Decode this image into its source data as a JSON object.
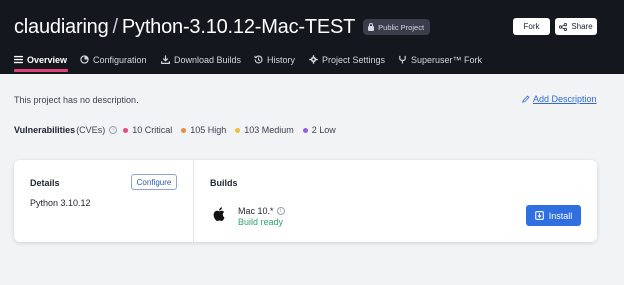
{
  "header": {
    "owner": "claudiaring",
    "separator": "/",
    "project": "Python-3.10.12-Mac-TEST",
    "visibility_badge": "Public Project",
    "fork_label": "Fork",
    "share_label": "Share"
  },
  "tabs": [
    {
      "label": "Overview",
      "icon": "list-icon",
      "active": true
    },
    {
      "label": "Configuration",
      "icon": "gear-swirl-icon"
    },
    {
      "label": "Download Builds",
      "icon": "download-icon"
    },
    {
      "label": "History",
      "icon": "history-icon"
    },
    {
      "label": "Project Settings",
      "icon": "gear-icon"
    },
    {
      "label": "Superuser™ Fork",
      "icon": "fork-icon"
    }
  ],
  "description": {
    "text": "This project has no description.",
    "add_label": "Add Description"
  },
  "vulnerabilities": {
    "title": "Vulnerabilities",
    "subtitle": "(CVEs)",
    "items": [
      {
        "label": "10 Critical",
        "color": "#e8467c"
      },
      {
        "label": "105 High",
        "color": "#f08a3c"
      },
      {
        "label": "103 Medium",
        "color": "#f2c036"
      },
      {
        "label": "2 Low",
        "color": "#9a5cf0"
      }
    ]
  },
  "details": {
    "title": "Details",
    "configure_label": "Configure",
    "runtime": "Python 3.10.12"
  },
  "builds": {
    "title": "Builds",
    "platform": "Mac 10.*",
    "status": "Build ready",
    "install_label": "Install"
  },
  "colors": {
    "accent": "#e0427a",
    "primary": "#2f6fe0",
    "success": "#2aa76a",
    "topbar": "#15171e"
  }
}
